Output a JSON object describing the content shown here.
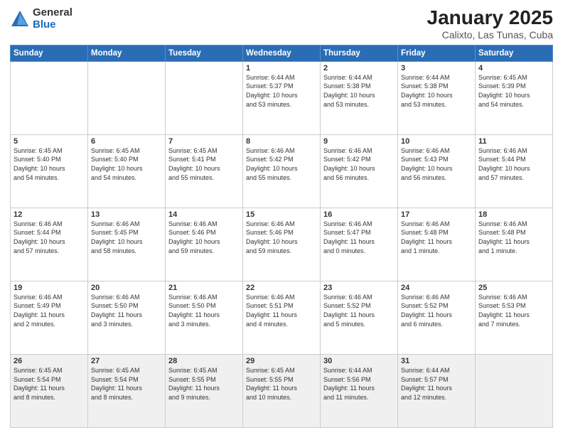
{
  "logo": {
    "general": "General",
    "blue": "Blue"
  },
  "header": {
    "title": "January 2025",
    "subtitle": "Calixto, Las Tunas, Cuba"
  },
  "days_of_week": [
    "Sunday",
    "Monday",
    "Tuesday",
    "Wednesday",
    "Thursday",
    "Friday",
    "Saturday"
  ],
  "weeks": [
    [
      {
        "day": "",
        "info": ""
      },
      {
        "day": "",
        "info": ""
      },
      {
        "day": "",
        "info": ""
      },
      {
        "day": "1",
        "info": "Sunrise: 6:44 AM\nSunset: 5:37 PM\nDaylight: 10 hours\nand 53 minutes."
      },
      {
        "day": "2",
        "info": "Sunrise: 6:44 AM\nSunset: 5:38 PM\nDaylight: 10 hours\nand 53 minutes."
      },
      {
        "day": "3",
        "info": "Sunrise: 6:44 AM\nSunset: 5:38 PM\nDaylight: 10 hours\nand 53 minutes."
      },
      {
        "day": "4",
        "info": "Sunrise: 6:45 AM\nSunset: 5:39 PM\nDaylight: 10 hours\nand 54 minutes."
      }
    ],
    [
      {
        "day": "5",
        "info": "Sunrise: 6:45 AM\nSunset: 5:40 PM\nDaylight: 10 hours\nand 54 minutes."
      },
      {
        "day": "6",
        "info": "Sunrise: 6:45 AM\nSunset: 5:40 PM\nDaylight: 10 hours\nand 54 minutes."
      },
      {
        "day": "7",
        "info": "Sunrise: 6:45 AM\nSunset: 5:41 PM\nDaylight: 10 hours\nand 55 minutes."
      },
      {
        "day": "8",
        "info": "Sunrise: 6:46 AM\nSunset: 5:42 PM\nDaylight: 10 hours\nand 55 minutes."
      },
      {
        "day": "9",
        "info": "Sunrise: 6:46 AM\nSunset: 5:42 PM\nDaylight: 10 hours\nand 56 minutes."
      },
      {
        "day": "10",
        "info": "Sunrise: 6:46 AM\nSunset: 5:43 PM\nDaylight: 10 hours\nand 56 minutes."
      },
      {
        "day": "11",
        "info": "Sunrise: 6:46 AM\nSunset: 5:44 PM\nDaylight: 10 hours\nand 57 minutes."
      }
    ],
    [
      {
        "day": "12",
        "info": "Sunrise: 6:46 AM\nSunset: 5:44 PM\nDaylight: 10 hours\nand 57 minutes."
      },
      {
        "day": "13",
        "info": "Sunrise: 6:46 AM\nSunset: 5:45 PM\nDaylight: 10 hours\nand 58 minutes."
      },
      {
        "day": "14",
        "info": "Sunrise: 6:46 AM\nSunset: 5:46 PM\nDaylight: 10 hours\nand 59 minutes."
      },
      {
        "day": "15",
        "info": "Sunrise: 6:46 AM\nSunset: 5:46 PM\nDaylight: 10 hours\nand 59 minutes."
      },
      {
        "day": "16",
        "info": "Sunrise: 6:46 AM\nSunset: 5:47 PM\nDaylight: 11 hours\nand 0 minutes."
      },
      {
        "day": "17",
        "info": "Sunrise: 6:46 AM\nSunset: 5:48 PM\nDaylight: 11 hours\nand 1 minute."
      },
      {
        "day": "18",
        "info": "Sunrise: 6:46 AM\nSunset: 5:48 PM\nDaylight: 11 hours\nand 1 minute."
      }
    ],
    [
      {
        "day": "19",
        "info": "Sunrise: 6:46 AM\nSunset: 5:49 PM\nDaylight: 11 hours\nand 2 minutes."
      },
      {
        "day": "20",
        "info": "Sunrise: 6:46 AM\nSunset: 5:50 PM\nDaylight: 11 hours\nand 3 minutes."
      },
      {
        "day": "21",
        "info": "Sunrise: 6:46 AM\nSunset: 5:50 PM\nDaylight: 11 hours\nand 3 minutes."
      },
      {
        "day": "22",
        "info": "Sunrise: 6:46 AM\nSunset: 5:51 PM\nDaylight: 11 hours\nand 4 minutes."
      },
      {
        "day": "23",
        "info": "Sunrise: 6:46 AM\nSunset: 5:52 PM\nDaylight: 11 hours\nand 5 minutes."
      },
      {
        "day": "24",
        "info": "Sunrise: 6:46 AM\nSunset: 5:52 PM\nDaylight: 11 hours\nand 6 minutes."
      },
      {
        "day": "25",
        "info": "Sunrise: 6:46 AM\nSunset: 5:53 PM\nDaylight: 11 hours\nand 7 minutes."
      }
    ],
    [
      {
        "day": "26",
        "info": "Sunrise: 6:45 AM\nSunset: 5:54 PM\nDaylight: 11 hours\nand 8 minutes."
      },
      {
        "day": "27",
        "info": "Sunrise: 6:45 AM\nSunset: 5:54 PM\nDaylight: 11 hours\nand 8 minutes."
      },
      {
        "day": "28",
        "info": "Sunrise: 6:45 AM\nSunset: 5:55 PM\nDaylight: 11 hours\nand 9 minutes."
      },
      {
        "day": "29",
        "info": "Sunrise: 6:45 AM\nSunset: 5:55 PM\nDaylight: 11 hours\nand 10 minutes."
      },
      {
        "day": "30",
        "info": "Sunrise: 6:44 AM\nSunset: 5:56 PM\nDaylight: 11 hours\nand 11 minutes."
      },
      {
        "day": "31",
        "info": "Sunrise: 6:44 AM\nSunset: 5:57 PM\nDaylight: 11 hours\nand 12 minutes."
      },
      {
        "day": "",
        "info": ""
      }
    ]
  ]
}
